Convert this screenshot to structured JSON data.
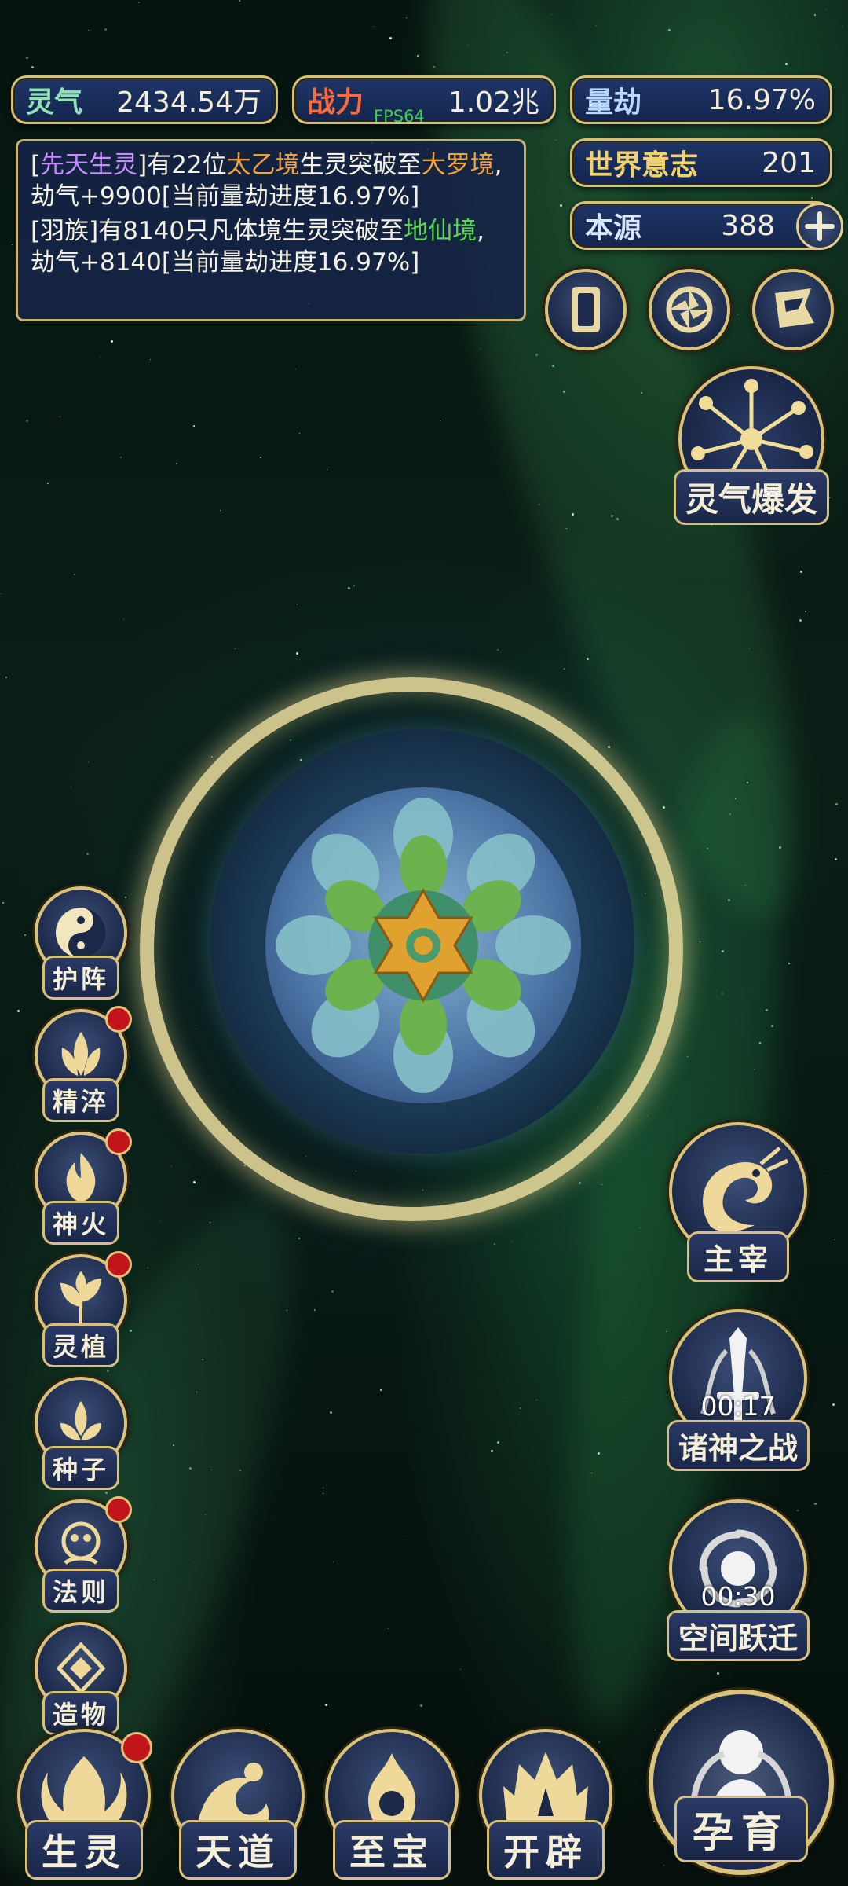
{
  "stats": {
    "lingqi": {
      "label": "灵气",
      "value": "2434.54万"
    },
    "zhanli": {
      "label": "战力",
      "value": "1.02兆"
    },
    "liangjie": {
      "label": "量劫",
      "value": "16.97%"
    },
    "shijie": {
      "label": "世界意志",
      "value": "201"
    },
    "benyuan": {
      "label": "本源",
      "value": "388"
    }
  },
  "fps": "FPS64",
  "log": {
    "m1": {
      "a": "[",
      "b": "先天生灵",
      "c": "]有22位",
      "d": "太乙境",
      "e": "生灵突破至",
      "f": "大罗境",
      "g": ", 劫气+9900[当前量劫进度16.97%]"
    },
    "m2": {
      "a": "[羽族]有8140只凡体境生灵突破至",
      "b": "地仙境",
      "c": ", 劫气+8140[当前量劫进度16.97%]"
    }
  },
  "right_buttons": {
    "burst": "灵气爆发",
    "zhuzai": "主宰",
    "zhushen": {
      "label": "诸神之战",
      "timer": "00:17"
    },
    "kongjian": {
      "label": "空间跃迁",
      "timer": "00:30"
    },
    "yunyu": "孕育"
  },
  "left_buttons": [
    "护阵",
    "精淬",
    "神火",
    "灵植",
    "种子",
    "法则",
    "造物"
  ],
  "bottom_buttons": [
    "生灵",
    "天道",
    "至宝",
    "开辟"
  ],
  "colors": {
    "gold": "#d8c27a",
    "panel": "#1f3566",
    "alert": "#c1141b"
  }
}
